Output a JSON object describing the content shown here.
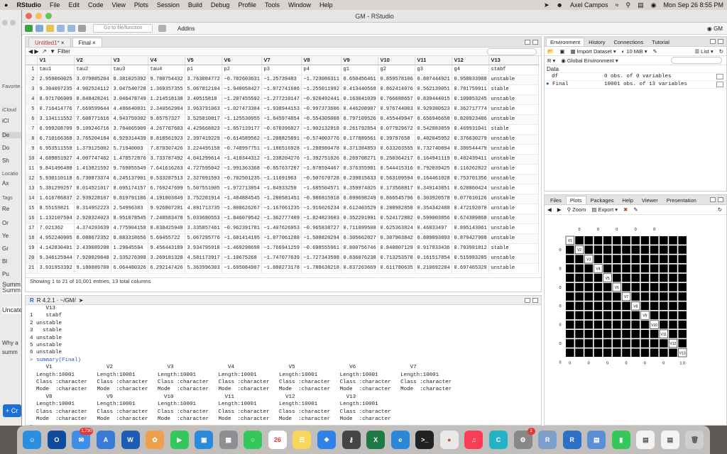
{
  "menubar": {
    "apple": "",
    "app": "RStudio",
    "items": [
      "File",
      "Edit",
      "Code",
      "View",
      "Plots",
      "Session",
      "Build",
      "Debug",
      "Profile",
      "Tools",
      "Window",
      "Help"
    ],
    "user": "Axel Campos",
    "datetime": "Mon Sep 26  8:55 PM"
  },
  "bgapp": {
    "labels": {
      "favorites": "Favorite",
      "icloud": "iCloud",
      "locations": "Locatio",
      "tags": "Tags"
    },
    "items": [
      "iCl",
      "De",
      "Do",
      "Sh",
      "Ax",
      "Re",
      "Or",
      "Ye",
      "Gr",
      "Bl",
      "Pu"
    ],
    "texts": [
      "Summ",
      "Summ",
      "Uncate",
      "Why a",
      "summ"
    ],
    "create": "Cr"
  },
  "window": {
    "title": "GM - RStudio"
  },
  "toolbar": {
    "goto_placeholder": "Go to file/function",
    "addins": "Addins",
    "project": "GM"
  },
  "source": {
    "tabs": [
      {
        "label": "Untitled1*"
      },
      {
        "label": "Final"
      }
    ],
    "filter": "Filter"
  },
  "table": {
    "headers": [
      "",
      "V1",
      "V2",
      "V3",
      "V4",
      "V5",
      "V6",
      "V7",
      "V8",
      "V9",
      "V10",
      "V11",
      "V12",
      "V13"
    ],
    "rows": [
      [
        "1",
        "tau1",
        "tau2",
        "tau3",
        "tau4",
        "p1",
        "p2",
        "p3",
        "p4",
        "g1",
        "g2",
        "g3",
        "g4",
        "stabf"
      ],
      [
        "2",
        "2.959060025",
        "3.079885204",
        "8.381025392",
        "9.780754432",
        "3.763084772",
        "−0.782603631",
        "−1.25739483",
        "−1.723086311",
        "0.650456461",
        "0.859578106",
        "0.887444921",
        "0.958033988",
        "unstable"
      ],
      [
        "3",
        "9.304097235",
        "4.902524112",
        "3.047540728",
        "1.369357355",
        "5.067812104",
        "−1.940058427",
        "−1.872741686",
        "−1.255011992",
        "0.413440568",
        "0.862414076",
        "0.562139051",
        "0.781759911",
        "stable"
      ],
      [
        "4",
        "8.971706909",
        "8.848428241",
        "3.046478749",
        "1.214518138",
        "3.40515818",
        "−1.207455592",
        "−1.277210147",
        "−0.920492441",
        "0.163041039",
        "0.766688657",
        "0.839444015",
        "0.109853245",
        "unstable"
      ],
      [
        "5",
        "0.716414776",
        "7.669599644",
        "4.486640831",
        "2.340562984",
        "3.963791063",
        "−1.027473304",
        "−1.938944153",
        "−0.997373606",
        "0.446208907",
        "0.976744083",
        "0.929380523",
        "0.362717774",
        "unstable"
      ],
      [
        "6",
        "3.134111552",
        "7.608771616",
        "4.943759302",
        "9.85757327",
        "3.525810817",
        "−1.125530955",
        "−1.845974854",
        "−0.554305008",
        "0.797109526",
        "0.455449947",
        "0.656946658",
        "0.820923486",
        "unstable"
      ],
      [
        "7",
        "6.999208709",
        "9.109246716",
        "3.784065909",
        "4.267787603",
        "4.429668823",
        "−1.857139177",
        "−0.670396827",
        "−1.902132818",
        "0.261792854",
        "0.077929672",
        "0.542883859",
        "0.469931041",
        "stable"
      ],
      [
        "8",
        "6.710166368",
        "3.765204184",
        "6.929314439",
        "8.818561923",
        "2.397419229",
        "−0.614589562",
        "−1.208825891",
        "−0.574003776",
        "0.177889561",
        "0.39797658",
        "0.402045952",
        "0.376630279",
        "unstable"
      ],
      [
        "9",
        "6.953511558",
        "1.379125002",
        "5.71940003",
        "7.870307426",
        "3.224495158",
        "−0.748997751",
        "−1.186516928",
        "−1.288980478",
        "0.371384853",
        "0.633203555",
        "0.732740894",
        "0.380544479",
        "unstable"
      ],
      [
        "10",
        "4.689851927",
        "4.007747462",
        "1.478572876",
        "3.733787492",
        "4.041299614",
        "−1.410344312",
        "−1.238204276",
        "−1.392751026",
        "0.269708271",
        "0.250364217",
        "0.164941119",
        "0.482439411",
        "unstable"
      ],
      [
        "11",
        "9.841496488",
        "1.413821592",
        "9.769855549",
        "7.641616263",
        "4.727595042",
        "−1.991363368",
        "−0.857637207",
        "−1.878594467",
        "0.376355981",
        "0.544415316",
        "0.792039425",
        "0.116262822",
        "unstable"
      ],
      [
        "12",
        "5.930110118",
        "6.730873374",
        "6.245137901",
        "0.533287513",
        "2.327091593",
        "−0.702501235",
        "−1.11691963",
        "−0.507670728",
        "0.239815633",
        "0.563109594",
        "0.164461028",
        "0.753701356",
        "unstable"
      ],
      [
        "13",
        "5.381299257",
        "8.014521017",
        "8.095174157",
        "6.769247699",
        "5.507551005",
        "−1.972713854",
        "−1.84933258",
        "−1.685504571",
        "0.359974025",
        "0.173568817",
        "0.349143851",
        "0.628860424",
        "unstable"
      ],
      [
        "14",
        "1.616786837",
        "2.939228107",
        "0.819791186",
        "4.191803849",
        "3.752281914",
        "−1.484884545",
        "−1.280581451",
        "−0.986815918",
        "0.899698249",
        "0.866545796",
        "0.303920578",
        "0.077610126",
        "unstable"
      ],
      [
        "15",
        "8.55159821",
        "8.314952223",
        "2.54996383",
        "9.926807281",
        "4.891713735",
        "−1.808626267",
        "−1.167061235",
        "−1.916026234",
        "0.612403529",
        "0.280982858",
        "0.354342488",
        "0.472192078",
        "unstable"
      ],
      [
        "16",
        "1.132107594",
        "2.920324023",
        "8.951078545",
        "7.248583478",
        "5.033680553",
        "−1.846079542",
        "−1.362777409",
        "−1.824823603",
        "0.352291991",
        "0.524172882",
        "0.599003856",
        "0.674389868",
        "unstable"
      ],
      [
        "17",
        "7.021362",
        "4.374293639",
        "4.775904158",
        "8.838425948",
        "3.335857461",
        "−0.962391781",
        "−1.407626953",
        "−0.965838727",
        "0.711099508",
        "0.625363824",
        "0.46833497",
        "0.895143061",
        "unstable"
      ],
      [
        "18",
        "4.952240905",
        "8.088672352",
        "8.883318656",
        "5.69455722",
        "5.067295776",
        "−1.681414195",
        "−1.877061288",
        "−1.508820294",
        "0.305662027",
        "0.307903842",
        "0.889893893",
        "0.879427908",
        "unstable"
      ],
      [
        "19",
        "4.142830401",
        "2.439089208",
        "1.29045594",
        "9.456443189",
        "3.934795918",
        "−1.469298698",
        "−1.766941259",
        "−0.698555961",
        "0.800756746",
        "0.840807129",
        "0.917833436",
        "0.793981812",
        "stable"
      ],
      [
        "20",
        "9.346125944",
        "7.920029848",
        "2.335276308",
        "3.269181328",
        "4.581173917",
        "−1.10675268",
        "−1.747077639",
        "−1.727343598",
        "0.836076238",
        "0.713253578",
        "0.161517854",
        "0.515983285",
        "unstable"
      ],
      [
        "21",
        "3.931953392",
        "9.180889708",
        "6.064480326",
        "6.292147426",
        "5.363996303",
        "−1.695084907",
        "−1.880273178",
        "−1.788638218",
        "0.837263669",
        "0.611780635",
        "0.210692284",
        "0.697465329",
        "unstable"
      ]
    ],
    "status": "Showing 1 to 21 of 10,001 entries, 13 total columns"
  },
  "console": {
    "header": "R 4.2.1 · ~/GM/",
    "lines": [
      "     V13",
      "1    stabf",
      "2 unstable",
      "3   stable",
      "4 unstable",
      "5 unstable",
      "6 unstable",
      "> summary(Final)",
      "     V1                 V2                 V3                 V4                 V5                 V6                 V7",
      "  Length:10001       Length:10001       Length:10001       Length:10001       Length:10001       Length:10001       Length:10001",
      "  Class :character   Class :character   Class :character   Class :character   Class :character   Class :character   Class :character",
      "  Mode  :character   Mode  :character   Mode  :character   Mode  :character   Mode  :character   Mode  :character   Mode  :character",
      "     V8                 V9                V10                V11                V12                V13",
      "  Length:10001       Length:10001       Length:10001       Length:10001       Length:10001       Length:10001",
      "  Class :character   Class :character   Class :character   Class :character   Class :character   Class :character",
      "  Mode  :character   Mode  :character   Mode  :character   Mode  :character   Mode  :character   Mode  :character"
    ]
  },
  "env": {
    "tabs": [
      "Environment",
      "History",
      "Connections",
      "Tutorial"
    ],
    "import": "Import Dataset",
    "memory": "10 MiB",
    "list": "List",
    "lang": "R",
    "scope": "Global Environment",
    "section": "Data",
    "rows": [
      {
        "name": "df",
        "value": "0 obs. of 0 variables"
      },
      {
        "name": "Final",
        "value": "10001 obs. of 13 variables"
      }
    ]
  },
  "plots": {
    "tabs": [
      "Files",
      "Plots",
      "Packages",
      "Help",
      "Viewer",
      "Presentation"
    ],
    "zoom": "Zoom",
    "export": "Export",
    "vars": [
      "V1",
      "V2",
      "V3",
      "V4",
      "V5",
      "V6",
      "V7",
      "V8",
      "V9",
      "V10",
      "V11",
      "V12",
      "V13"
    ],
    "ticks_top": [
      "0",
      "0",
      "0",
      "0",
      "0"
    ],
    "ticks_bottom": [
      "0",
      "0",
      "0",
      "0",
      "0",
      "0",
      "1.0"
    ],
    "ticks_left": [
      "0",
      "0",
      "0",
      "0",
      "0",
      "0",
      "0"
    ]
  },
  "colors": {
    "accent": "#1e6fd6",
    "stable": "#000000"
  }
}
